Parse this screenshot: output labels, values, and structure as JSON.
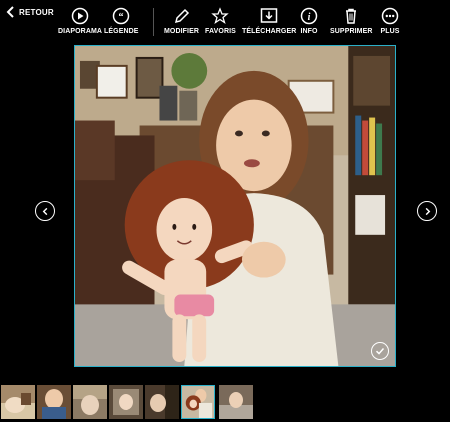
{
  "toolbar": {
    "back_label": "RETOUR",
    "buttons": [
      {
        "id": "slideshow",
        "label": "DIAPORAMA",
        "icon": "play-circle-icon"
      },
      {
        "id": "caption",
        "label": "LÉGENDE",
        "icon": "quote-circle-icon"
      },
      {
        "id": "edit",
        "label": "MODIFIER",
        "icon": "pencil-icon"
      },
      {
        "id": "favorites",
        "label": "FAVORIS",
        "icon": "star-icon"
      },
      {
        "id": "download",
        "label": "TÉLÉCHARGER",
        "icon": "download-icon"
      },
      {
        "id": "info",
        "label": "INFO",
        "icon": "info-icon"
      },
      {
        "id": "delete",
        "label": "SUPPRIMER",
        "icon": "trash-icon"
      },
      {
        "id": "more",
        "label": "PLUS",
        "icon": "more-dots-icon"
      }
    ]
  },
  "viewer": {
    "prev_icon": "chevron-left-icon",
    "next_icon": "chevron-right-icon",
    "selected_icon": "checkmark-icon",
    "accent": "#2bb0c9"
  },
  "filmstrip": {
    "count": 7,
    "selected_index": 5
  }
}
